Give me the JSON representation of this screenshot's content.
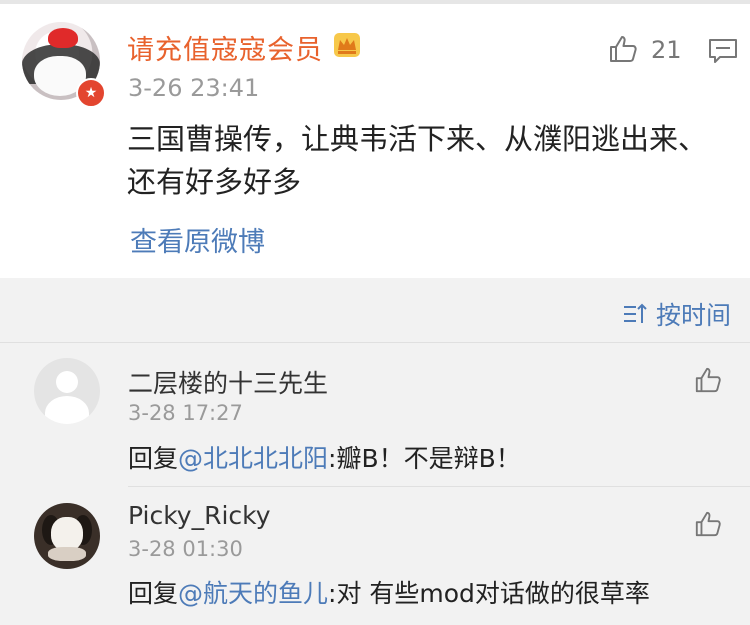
{
  "post": {
    "author": "请充值寇寇会员",
    "time": "3-26 23:41",
    "like_count": "21",
    "content": "三国曹操传，让典韦活下来、从濮阳逃出来、还有好多好多",
    "view_original": "查看原微博",
    "badge_icon": "verified-badge-icon",
    "vip_icon": "crown-icon"
  },
  "sort": {
    "label": "按时间",
    "icon": "sort-icon"
  },
  "comments": [
    {
      "author": "二层楼的十三先生",
      "time": "3-28 17:27",
      "reply_prefix": "回复",
      "mention": "@北北北北阳",
      "text": ":瓣B！不是辩B！"
    },
    {
      "author": "Picky_Ricky",
      "time": "3-28 01:30",
      "reply_prefix": "回复",
      "mention": "@航天的鱼儿",
      "text": ":对 有些mod对话做的很草率"
    }
  ],
  "colors": {
    "author_vip": "#e8622d",
    "link": "#4d7bb8",
    "background": "#f2f2f2"
  }
}
